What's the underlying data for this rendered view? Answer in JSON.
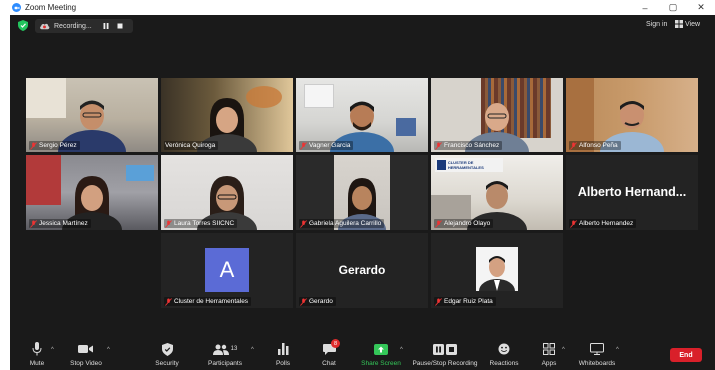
{
  "window": {
    "title": "Zoom Meeting",
    "controls": [
      "–",
      "▢",
      "✕"
    ]
  },
  "topbar": {
    "recording_label": "Recording...",
    "sign_in": "Sign in",
    "view": "View"
  },
  "participants": [
    {
      "name": "Sergio Pérez",
      "type": "video"
    },
    {
      "name": "Verónica Quiroga",
      "type": "video",
      "active": true
    },
    {
      "name": "Vagner Garcia",
      "type": "video"
    },
    {
      "name": "Francisco Sánchez",
      "type": "video"
    },
    {
      "name": "Alfonso Peña",
      "type": "video"
    },
    {
      "name": "Jessica Martínez",
      "type": "video"
    },
    {
      "name": "Laura Torres SIICNC",
      "type": "video"
    },
    {
      "name": "Gabriela Aguilera Carrillo",
      "type": "video"
    },
    {
      "name": "Alejandro Olayo",
      "type": "video"
    },
    {
      "name": "Alberto Hernandez",
      "type": "name",
      "display": "Alberto  Hernand..."
    },
    {
      "name": "Cluster de Herramentales",
      "type": "avatar",
      "letter": "A"
    },
    {
      "name": "Gerardo",
      "type": "name",
      "display": "Gerardo"
    },
    {
      "name": "Edgar Ruiz Plata",
      "type": "photo"
    }
  ],
  "cluster_logo_text": "CLUSTER DE HERRAMENTALES",
  "toolbar": {
    "mute": "Mute",
    "stop_video": "Stop Video",
    "security": "Security",
    "participants": "Participants",
    "participants_count": "13",
    "polls": "Polls",
    "chat": "Chat",
    "chat_badge": "8",
    "share_screen": "Share Screen",
    "pause_recording": "Pause/Stop Recording",
    "reactions": "Reactions",
    "apps": "Apps",
    "whiteboards": "Whiteboards",
    "end": "End"
  },
  "colors": {
    "active_speaker": "#c9e265",
    "end_button": "#d9202a",
    "share_green": "#34c759",
    "avatar_blue": "#5b6bd6"
  }
}
